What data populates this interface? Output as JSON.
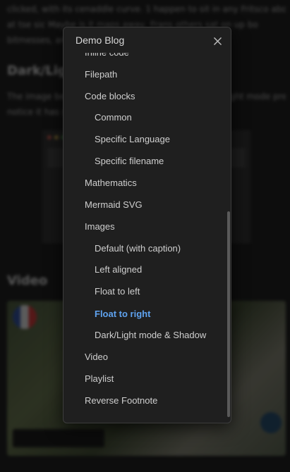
{
  "background": {
    "paragraph_lines": [
      "clicked, with its cenaddle curve. 1 happen to sit in any Fritsco abouen",
      "at tse sic Maybe is it maps away, Frans others sat on up bo",
      "bitmesses, and bold"
    ],
    "section_heading_1": "Dark/Light",
    "paragraph2_lines": [
      "The image below changes depending on your dark/light mode preference,",
      "notice it has st"
    ],
    "section_heading_2": "Video"
  },
  "modal": {
    "title": "Demo Blog",
    "close_icon": "close-icon",
    "toc": [
      {
        "label": "Inline code",
        "level": 2,
        "active": false
      },
      {
        "label": "Filepath",
        "level": 2,
        "active": false
      },
      {
        "label": "Code blocks",
        "level": 2,
        "active": false
      },
      {
        "label": "Common",
        "level": 3,
        "active": false
      },
      {
        "label": "Specific Language",
        "level": 3,
        "active": false
      },
      {
        "label": "Specific filename",
        "level": 3,
        "active": false
      },
      {
        "label": "Mathematics",
        "level": 2,
        "active": false
      },
      {
        "label": "Mermaid SVG",
        "level": 2,
        "active": false
      },
      {
        "label": "Images",
        "level": 2,
        "active": false
      },
      {
        "label": "Default (with caption)",
        "level": 3,
        "active": false
      },
      {
        "label": "Left aligned",
        "level": 3,
        "active": false
      },
      {
        "label": "Float to left",
        "level": 3,
        "active": false
      },
      {
        "label": "Float to right",
        "level": 3,
        "active": true
      },
      {
        "label": "Dark/Light mode & Shadow",
        "level": 3,
        "active": false
      },
      {
        "label": "Video",
        "level": 2,
        "active": false
      },
      {
        "label": "Playlist",
        "level": 2,
        "active": false
      },
      {
        "label": "Reverse Footnote",
        "level": 2,
        "active": false
      }
    ]
  },
  "colors": {
    "active_link": "#5fa3f0",
    "modal_bg": "#1f1f1f",
    "page_bg": "#151515"
  }
}
